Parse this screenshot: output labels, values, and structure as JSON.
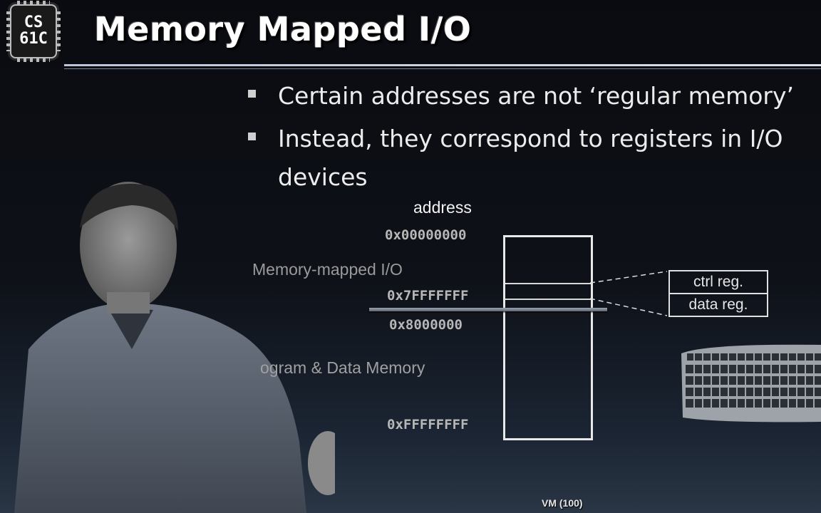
{
  "logo": {
    "line1": "CS",
    "line2": "61C"
  },
  "title": "Memory Mapped I/O",
  "bullets": [
    "Certain addresses are not ‘regular memory’",
    "Instead, they correspond to registers in I/O devices"
  ],
  "diagram": {
    "address_heading": "address",
    "addresses": [
      "0x00000000",
      "0x7FFFFFFF",
      "0x8000000",
      "0xFFFFFFFF"
    ],
    "regions": [
      "Memory-mapped I/O",
      "ogram & Data Memory"
    ],
    "registers": [
      "ctrl reg.",
      "data reg."
    ]
  },
  "footer": "VM (100)",
  "colors": {
    "background": "#0e1118",
    "title": "#ffffff",
    "box": "#e8e8e8"
  }
}
